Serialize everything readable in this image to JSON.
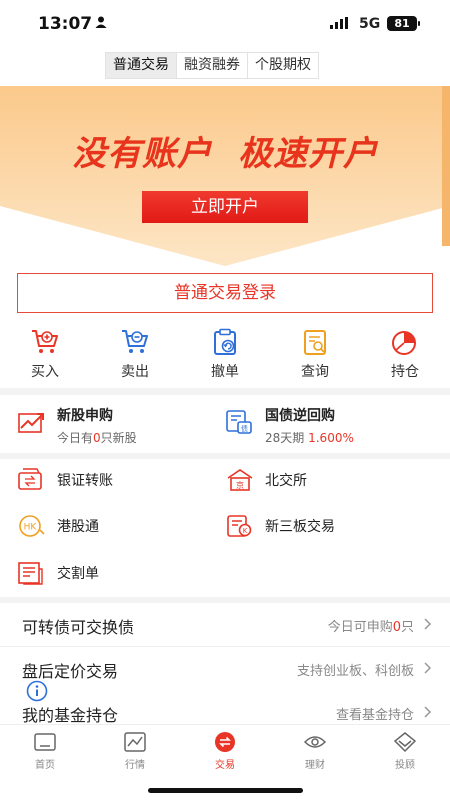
{
  "status": {
    "time": "13:07",
    "network": "5G",
    "battery": "81"
  },
  "top_tabs": [
    "普通交易",
    "融资融券",
    "个股期权"
  ],
  "banner": {
    "slogan_left": "没有账户",
    "slogan_right": "极速开户",
    "button": "立即开户"
  },
  "login_button": "普通交易登录",
  "quick_actions": [
    {
      "label": "买入",
      "icon": "cart-plus-icon"
    },
    {
      "label": "卖出",
      "icon": "cart-minus-icon"
    },
    {
      "label": "撤单",
      "icon": "clipboard-undo-icon"
    },
    {
      "label": "查询",
      "icon": "document-search-icon"
    },
    {
      "label": "持仓",
      "icon": "pie-chart-icon"
    }
  ],
  "features": {
    "ipo": {
      "title": "新股申购",
      "sub_prefix": "今日有",
      "sub_count": "0",
      "sub_suffix": "只新股"
    },
    "repo": {
      "title": "国债逆回购",
      "sub_term": "28天期",
      "sub_rate": "1.600%"
    },
    "bank_transfer": "银证转账",
    "bse": "北交所",
    "hk_connect": "港股通",
    "neeq": "新三板交易",
    "settlement": "交割单"
  },
  "list_rows": [
    {
      "title": "可转债可交换债",
      "right_prefix": "今日可申购",
      "right_count": "0",
      "right_suffix": "只"
    },
    {
      "title": "盘后定价交易",
      "right": "支持创业板、科创板"
    },
    {
      "title": "我的基金持仓",
      "right": "查看基金持仓"
    }
  ],
  "bottom_nav": [
    {
      "label": "首页",
      "icon": "home-icon"
    },
    {
      "label": "行情",
      "icon": "market-chart-icon"
    },
    {
      "label": "交易",
      "icon": "trade-swap-icon"
    },
    {
      "label": "理财",
      "icon": "wealth-eye-icon"
    },
    {
      "label": "投顾",
      "icon": "advisor-diamond-icon"
    }
  ],
  "colors": {
    "accent": "#e83526",
    "banner_bg": "#fbd9a8"
  }
}
